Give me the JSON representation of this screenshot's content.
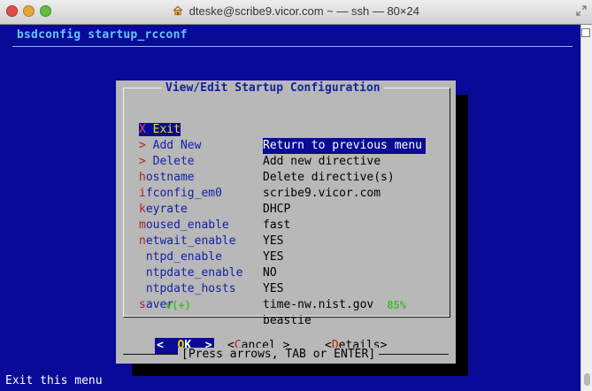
{
  "window": {
    "title": "dteske@scribe9.vicor.com ~ — ssh — 80×24"
  },
  "terminal": {
    "backtitle": "bsdconfig startup_rcconf",
    "status": "Exit this menu"
  },
  "dialog": {
    "title": "View/Edit Startup Configuration",
    "items": [
      {
        "first": "X",
        "rest": " Exit",
        "desc": "Return to previous menu",
        "selected": true
      },
      {
        "first": ">",
        "rest": " Add New",
        "desc": "Add new directive"
      },
      {
        "first": ">",
        "rest": " Delete",
        "desc": "Delete directive(s)"
      },
      {
        "first": "h",
        "rest": "ostname",
        "desc": "scribe9.vicor.com"
      },
      {
        "first": "i",
        "rest": "fconfig_em0",
        "desc": "DHCP"
      },
      {
        "first": "k",
        "rest": "eyrate",
        "desc": "fast"
      },
      {
        "first": "m",
        "rest": "oused_enable",
        "desc": "YES"
      },
      {
        "first": "n",
        "rest": "etwait_enable",
        "desc": "YES"
      },
      {
        "first": "",
        "rest": " ntpd_enable",
        "desc": "NO"
      },
      {
        "first": "",
        "rest": " ntpdate_enable",
        "desc": "YES"
      },
      {
        "first": "",
        "rest": " ntpdate_hosts",
        "desc": "time-nw.nist.gov"
      },
      {
        "first": "s",
        "rest": "aver",
        "desc": "beastie"
      }
    ],
    "scroll_indicator": "v(+)",
    "percent": "85%",
    "buttons": {
      "ok_left": "<",
      "ok_hot": "O",
      "ok_rest": "K",
      "ok_right": ">",
      "cancel_left": "<",
      "cancel_hot": "C",
      "cancel_rest": "ancel >",
      "details_left": "<",
      "details_hot": "D",
      "details_rest": "etails>"
    },
    "hint": "[Press arrows, TAB or ENTER]"
  },
  "colors": {
    "terminal_bg": "#0a0a98",
    "dialog_bg": "#b8b8b8",
    "title_blue": "#1420a8",
    "hotkey_red": "#b02020",
    "scroll_green": "#44b830"
  }
}
